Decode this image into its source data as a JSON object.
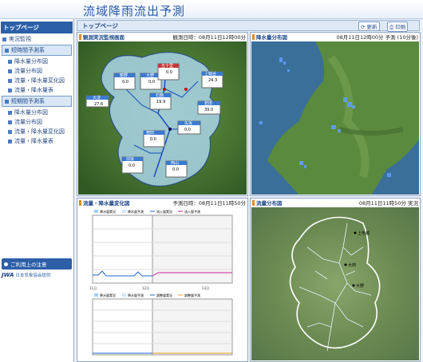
{
  "header": {
    "title": "流域降雨流出予測"
  },
  "sidebar": {
    "top": "トップページ",
    "live": "実況監視",
    "short_head": "短時間予測系",
    "short_items": [
      "降水量分布図",
      "流量分布図",
      "流量・降水量変化図",
      "流量・降水量表"
    ],
    "mid_head": "短期間予測系",
    "mid_items": [
      "降水量分布図",
      "流量分布図",
      "流量・降水量変化図",
      "流量・降水量表"
    ],
    "notice": "ご利用上の注意",
    "jwa_logo": "JWA",
    "jwa_text": "日本気象協会提供"
  },
  "main": {
    "title": "トップページ",
    "refresh": "更新",
    "print": "印刷"
  },
  "panels": {
    "monitor": {
      "title": "観測実況監視画面",
      "time": "観測日時：08月11日12時00分"
    },
    "rain_map": {
      "title": "降水量分布図",
      "time": "08月11日12時00分 予測 (10分後)"
    },
    "flow_chart": {
      "title": "流量・降水量変化図",
      "time": "予測日時：08月11日11時50分"
    },
    "flow_map": {
      "title": "流量分布図",
      "time": "08月11日11時50分 実況"
    }
  },
  "monitor_labels": [
    {
      "name": "大淀",
      "v1": "27.6"
    },
    {
      "name": "鏡野",
      "v1": "0.0"
    },
    {
      "name": "大野",
      "v1": "0.0"
    },
    {
      "name": "五十里",
      "v1": "0.0"
    },
    {
      "name": "上鍋谷",
      "v1": "24.3"
    },
    {
      "name": "石鍋",
      "v1": "19.9"
    },
    {
      "name": "矢坂",
      "v1": "0.0"
    },
    {
      "name": "若田",
      "v1": "39.0"
    },
    {
      "name": "宿田",
      "v1": "0.0"
    },
    {
      "name": "前坂",
      "v1": "0.0"
    },
    {
      "name": "西山",
      "v1": "0.0"
    }
  ],
  "flow_chart_legend_top": [
    "降水量実況",
    "降水量予測",
    "流入量実況",
    "流入量予測"
  ],
  "flow_chart_legend_bottom": [
    "降水量実況",
    "降水量予測",
    "調整量実況",
    "調整量予測"
  ],
  "chart_axis_times": [
    "11日",
    "12日",
    "13日"
  ],
  "flow_map_cities": [
    {
      "name": "上毛越"
    },
    {
      "name": "大田"
    },
    {
      "name": "大野"
    }
  ],
  "colors": {
    "brand": "#2c5fa8",
    "accent": "#e08a1e"
  }
}
